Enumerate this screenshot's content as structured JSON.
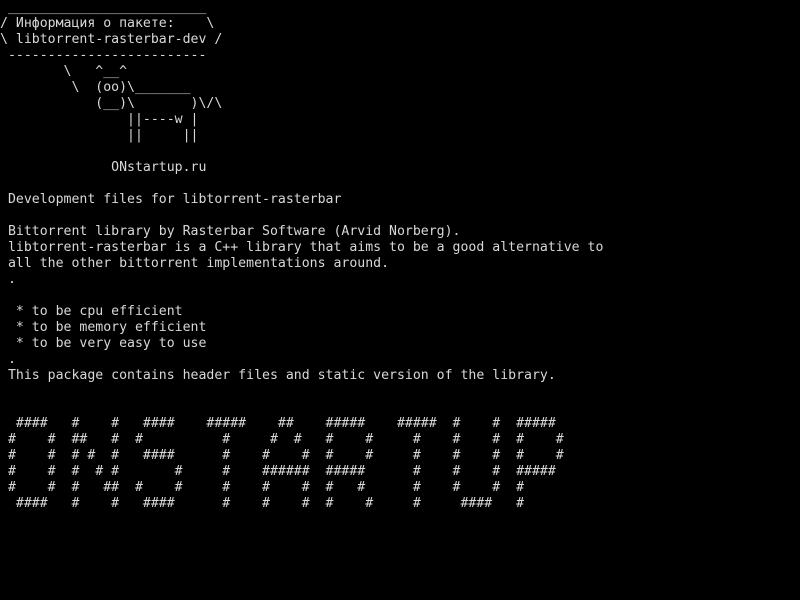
{
  "terminal": {
    "cowsay": {
      "top_border": " _________________________",
      "line1": "/ Информация о пакете:    \\",
      "line2": "\\ libtorrent-rasterbar-dev /",
      "bottom_border": " -------------------------",
      "cow1": "        \\   ^__^",
      "cow2": "         \\  (oo)\\_______",
      "cow3": "            (__)\\       )\\/\\",
      "cow4": "                ||----w |",
      "cow5": "                ||     ||",
      "signature": "              ONstartup.ru"
    },
    "description": {
      "summary": " Development files for libtorrent-rasterbar",
      "para1": " Bittorrent library by Rasterbar Software (Arvid Norberg).",
      "para2": " libtorrent-rasterbar is a C++ library that aims to be a good alternative to",
      "para3": " all the other bittorrent implementations around.",
      "sep1": " .",
      "bullet1": "  * to be cpu efficient",
      "bullet2": "  * to be memory efficient",
      "bullet3": "  * to be very easy to use",
      "sep2": " .",
      "para4": " This package contains header files and static version of the library."
    },
    "banner": [
      "  ####   #    #   ####    #####    ##    #####    #####  #    #  #####",
      " #    #  ##   #  #          #     #  #   #    #     #    #    #  #    #",
      " #    #  # #  #   ####      #    #    #  #    #     #    #    #  #    #",
      " #    #  #  # #       #     #    ######  #####      #    #    #  #####",
      " #    #  #   ##  #    #     #    #    #  #   #      #    #    #  #",
      "  ####   #    #   ####      #    #    #  #    #     #     ####   #"
    ]
  }
}
